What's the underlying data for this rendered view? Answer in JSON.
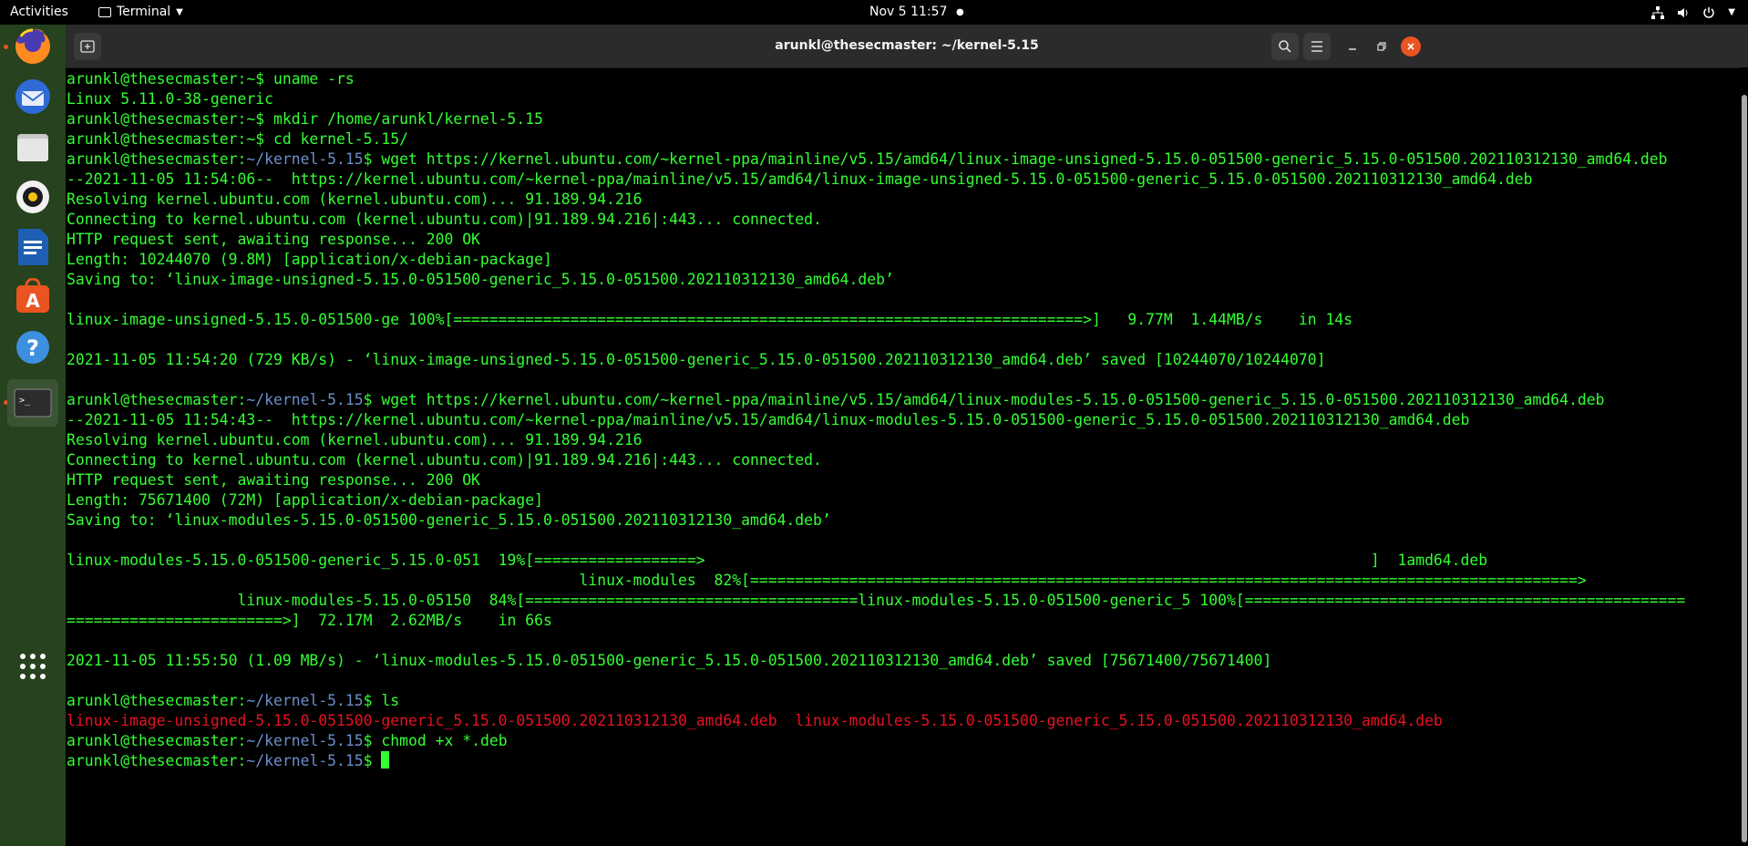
{
  "topbar": {
    "activities": "Activities",
    "app_name": "Terminal",
    "clock": "Nov 5  11:57"
  },
  "dock": {
    "items": [
      "firefox-icon",
      "thunderbird-icon",
      "files-icon",
      "rhythmbox-icon",
      "writer-icon",
      "software-icon",
      "help-icon",
      "terminal-icon",
      "app-grid-icon"
    ]
  },
  "window": {
    "title": "arunkl@thesecmaster: ~/kernel-5.15"
  },
  "colors": {
    "dock_bg": "#26421e",
    "term_text": "#33ff33",
    "prompt_path": "#6b8ec8",
    "ls_file": "#e81123"
  },
  "terminal": {
    "lines": [
      [
        {
          "t": "arunkl@thesecmaster:~$ uname -rs",
          "c": "u"
        }
      ],
      [
        {
          "t": "Linux 5.11.0-38-generic",
          "c": "u"
        }
      ],
      [
        {
          "t": "arunkl@thesecmaster:~$ mkdir /home/arunkl/kernel-5.15",
          "c": "u"
        }
      ],
      [
        {
          "t": "arunkl@thesecmaster:~$ cd kernel-5.15/",
          "c": "u"
        }
      ],
      [
        {
          "t": "arunkl@thesecmaster:",
          "c": "u"
        },
        {
          "t": "~/kernel-5.15",
          "c": "p"
        },
        {
          "t": "$ wget https://kernel.ubuntu.com/~kernel-ppa/mainline/v5.15/amd64/linux-image-unsigned-5.15.0-051500-generic_5.15.0-051500.202110312130_amd64.deb",
          "c": "u"
        }
      ],
      [
        {
          "t": "--2021-11-05 11:54:06--  https://kernel.ubuntu.com/~kernel-ppa/mainline/v5.15/amd64/linux-image-unsigned-5.15.0-051500-generic_5.15.0-051500.202110312130_amd64.deb",
          "c": "u"
        }
      ],
      [
        {
          "t": "Resolving kernel.ubuntu.com (kernel.ubuntu.com)... 91.189.94.216",
          "c": "u"
        }
      ],
      [
        {
          "t": "Connecting to kernel.ubuntu.com (kernel.ubuntu.com)|91.189.94.216|:443... connected.",
          "c": "u"
        }
      ],
      [
        {
          "t": "HTTP request sent, awaiting response... 200 OK",
          "c": "u"
        }
      ],
      [
        {
          "t": "Length: 10244070 (9.8M) [application/x-debian-package]",
          "c": "u"
        }
      ],
      [
        {
          "t": "Saving to: ‘linux-image-unsigned-5.15.0-051500-generic_5.15.0-051500.202110312130_amd64.deb’",
          "c": "u"
        }
      ],
      [],
      [
        {
          "t": "linux-image-unsigned-5.15.0-051500-ge 100%[======================================================================>]   9.77M  1.44MB/s    in 14s",
          "c": "u"
        }
      ],
      [],
      [
        {
          "t": "2021-11-05 11:54:20 (729 KB/s) - ‘linux-image-unsigned-5.15.0-051500-generic_5.15.0-051500.202110312130_amd64.deb’ saved [10244070/10244070]",
          "c": "u"
        }
      ],
      [],
      [
        {
          "t": "arunkl@thesecmaster:",
          "c": "u"
        },
        {
          "t": "~/kernel-5.15",
          "c": "p"
        },
        {
          "t": "$ wget https://kernel.ubuntu.com/~kernel-ppa/mainline/v5.15/amd64/linux-modules-5.15.0-051500-generic_5.15.0-051500.202110312130_amd64.deb",
          "c": "u"
        }
      ],
      [
        {
          "t": "--2021-11-05 11:54:43--  https://kernel.ubuntu.com/~kernel-ppa/mainline/v5.15/amd64/linux-modules-5.15.0-051500-generic_5.15.0-051500.202110312130_amd64.deb",
          "c": "u"
        }
      ],
      [
        {
          "t": "Resolving kernel.ubuntu.com (kernel.ubuntu.com)... 91.189.94.216",
          "c": "u"
        }
      ],
      [
        {
          "t": "Connecting to kernel.ubuntu.com (kernel.ubuntu.com)|91.189.94.216|:443... connected.",
          "c": "u"
        }
      ],
      [
        {
          "t": "HTTP request sent, awaiting response... 200 OK",
          "c": "u"
        }
      ],
      [
        {
          "t": "Length: 75671400 (72M) [application/x-debian-package]",
          "c": "u"
        }
      ],
      [
        {
          "t": "Saving to: ‘linux-modules-5.15.0-051500-generic_5.15.0-051500.202110312130_amd64.deb’",
          "c": "u"
        }
      ],
      [],
      [
        {
          "t": "linux-modules-5.15.0-051500-generic_5.15.0-051  19%[==================>                                                                          ]  1amd64.deb",
          "c": "u"
        }
      ],
      [
        {
          "t": "                                                         linux-modules  82%[============================================================================================>",
          "c": "u"
        }
      ],
      [
        {
          "t": "                   linux-modules-5.15.0-05150  84%[=====================================linux-modules-5.15.0-051500-generic_5 100%[=================================================",
          "c": "u"
        }
      ],
      [
        {
          "t": "========================>]  72.17M  2.62MB/s    in 66s",
          "c": "u"
        }
      ],
      [],
      [
        {
          "t": "2021-11-05 11:55:50 (1.09 MB/s) - ‘linux-modules-5.15.0-051500-generic_5.15.0-051500.202110312130_amd64.deb’ saved [75671400/75671400]",
          "c": "u"
        }
      ],
      [],
      [
        {
          "t": "arunkl@thesecmaster:",
          "c": "u"
        },
        {
          "t": "~/kernel-5.15",
          "c": "p"
        },
        {
          "t": "$ ls",
          "c": "u"
        }
      ],
      [
        {
          "t": "linux-image-unsigned-5.15.0-051500-generic_5.15.0-051500.202110312130_amd64.deb  linux-modules-5.15.0-051500-generic_5.15.0-051500.202110312130_amd64.deb",
          "c": "r"
        }
      ],
      [
        {
          "t": "arunkl@thesecmaster:",
          "c": "u"
        },
        {
          "t": "~/kernel-5.15",
          "c": "p"
        },
        {
          "t": "$ chmod +x *.deb",
          "c": "u"
        }
      ],
      [
        {
          "t": "arunkl@thesecmaster:",
          "c": "u"
        },
        {
          "t": "~/kernel-5.15",
          "c": "p"
        },
        {
          "t": "$ ",
          "c": "u"
        },
        {
          "cursor": true
        }
      ]
    ]
  }
}
